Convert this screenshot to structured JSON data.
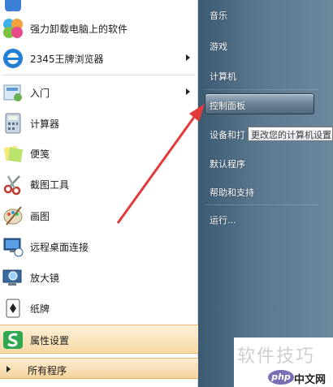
{
  "programs": [
    {
      "label": "",
      "icon": "app-icon",
      "has_submenu": false
    },
    {
      "label": "强力卸载电脑上的软件",
      "icon": "uninstall-icon",
      "has_submenu": false
    },
    {
      "label": "2345王牌浏览器",
      "icon": "browser-icon",
      "has_submenu": true
    },
    {
      "label": "入门",
      "icon": "getting-started-icon",
      "has_submenu": true
    },
    {
      "label": "计算器",
      "icon": "calculator-icon",
      "has_submenu": false
    },
    {
      "label": "便笺",
      "icon": "sticky-notes-icon",
      "has_submenu": false
    },
    {
      "label": "截图工具",
      "icon": "snipping-tool-icon",
      "has_submenu": false
    },
    {
      "label": "画图",
      "icon": "paint-icon",
      "has_submenu": false
    },
    {
      "label": "远程桌面连接",
      "icon": "remote-desktop-icon",
      "has_submenu": false
    },
    {
      "label": "放大镜",
      "icon": "magnifier-icon",
      "has_submenu": false
    },
    {
      "label": "纸牌",
      "icon": "solitaire-icon",
      "has_submenu": false
    },
    {
      "label": "属性设置",
      "icon": "property-settings-icon",
      "has_submenu": false,
      "highlighted": true
    }
  ],
  "all_programs_label": "所有程序",
  "right_items": [
    {
      "label": "音乐"
    },
    {
      "label": "游戏"
    },
    {
      "label": "计算机"
    },
    {
      "label": "控制面板",
      "selected": true
    },
    {
      "label": "设备和打"
    },
    {
      "label": "默认程序"
    },
    {
      "label": "帮助和支持"
    },
    {
      "label": "运行..."
    }
  ],
  "tooltip": "更改您的计算机设置",
  "watermark": {
    "title": "软件技巧",
    "logo": "php",
    "sub": "中文网"
  },
  "colors": {
    "accent_arrow": "#e23a3a",
    "right_pane": "#4f6d84",
    "highlight": "#f7d9a4"
  }
}
